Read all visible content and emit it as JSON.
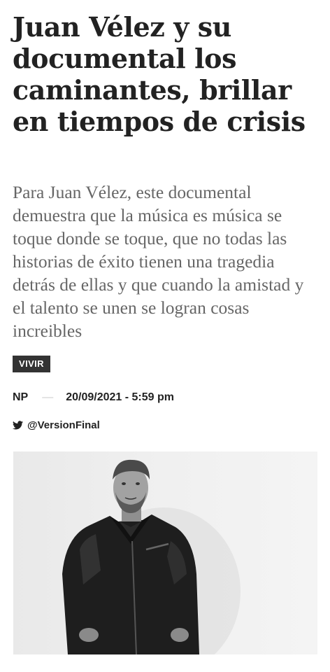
{
  "article": {
    "headline": "Juan Vélez y su documental los caminantes, brillar en tiempos de crisis",
    "deck": "Para Juan Vélez, este documental demuestra que la música es música se toque donde se toque, que no todas las historias de éxito tienen una tragedia detrás de ellas y que cuando la amistad y el talento se unen se logran cosas increibles",
    "category": "VIVIR",
    "author": "NP",
    "separator": "—",
    "date": "20/09/2021 - 5:59 pm",
    "twitter_handle": "@VersionFinal",
    "twitter_icon": "twitter-bird-icon"
  },
  "colors": {
    "headline": "#222222",
    "deck": "#666666",
    "category_bg": "#333333",
    "category_text": "#ffffff"
  }
}
